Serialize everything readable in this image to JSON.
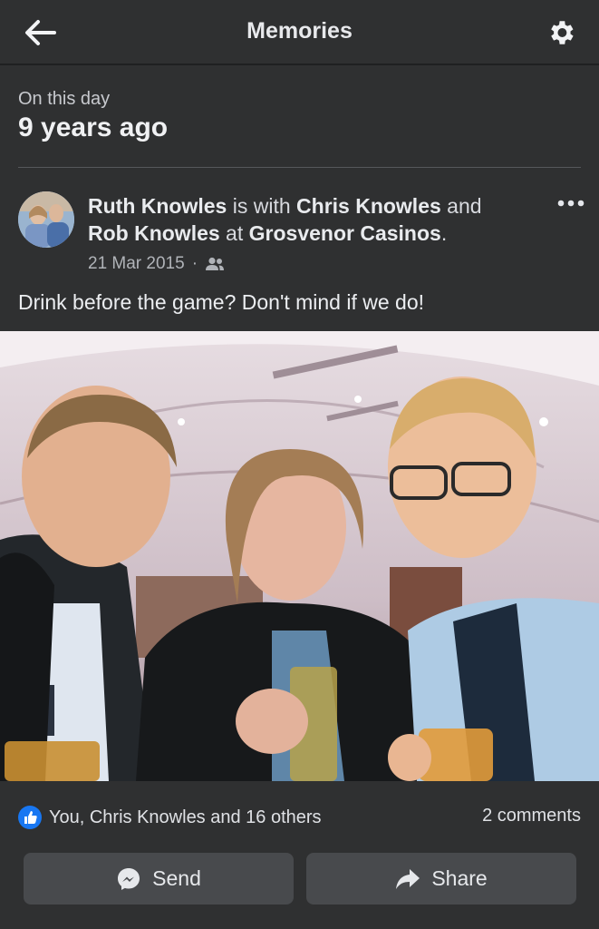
{
  "header": {
    "title": "Memories",
    "back_icon": "arrow-left-icon",
    "settings_icon": "gear-icon"
  },
  "on_this_day": {
    "label": "On this day",
    "years_ago": "9 years ago"
  },
  "post": {
    "author": "Ruth Knowles",
    "with_text": " is with ",
    "tagged_1": "Chris Knowles",
    "and_text": " and ",
    "tagged_2": "Rob Knowles",
    "at_text": " at ",
    "place": "Grosvenor Casinos",
    "period": ".",
    "date": "21 Mar 2015",
    "separator": "·",
    "audience_icon": "friends-icon",
    "more_icon": "more-horizontal-icon",
    "text": "Drink before the game? Don't mind if we do!"
  },
  "footer": {
    "like_icon": "thumbs-up-icon",
    "reactions_text": "You, Chris Knowles and 16 others",
    "comments_text": "2 comments",
    "send_label": "Send",
    "send_icon": "messenger-icon",
    "share_label": "Share",
    "share_icon": "share-arrow-icon"
  },
  "colors": {
    "background": "#2f3031",
    "button": "#484a4d",
    "like_blue": "#1877f2"
  }
}
